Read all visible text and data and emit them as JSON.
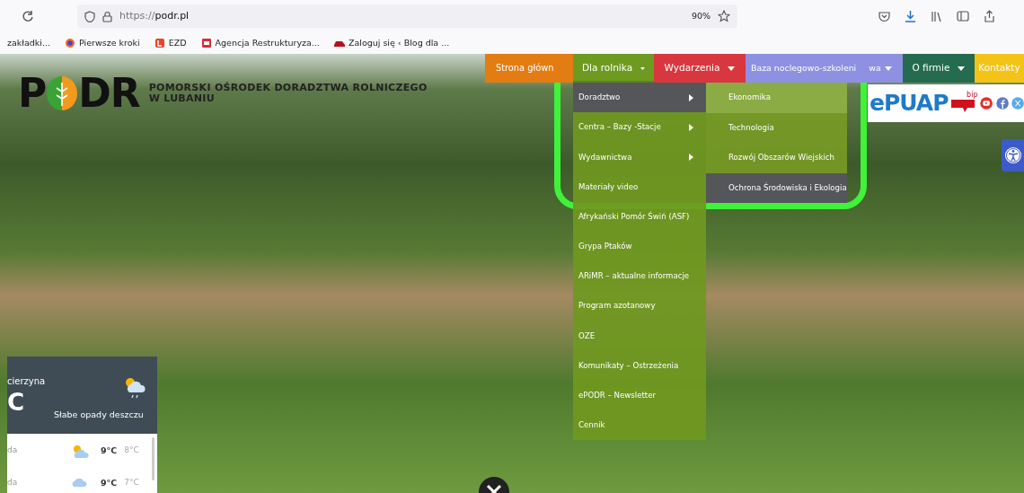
{
  "browser": {
    "url_scheme": "https://",
    "url_host": "podr.pl",
    "zoom": "90%",
    "bookmarks": [
      {
        "label": "zakładki...",
        "kind": "plain"
      },
      {
        "label": "Pierwsze kroki",
        "kind": "firefox"
      },
      {
        "label": "EZD",
        "kind": "ezd"
      },
      {
        "label": "Agencja Restrukturyza...",
        "kind": "agency"
      },
      {
        "label": "Zaloguj się ‹ Blog dla ...",
        "kind": "car"
      }
    ]
  },
  "site": {
    "logo": {
      "left": "P",
      "right": "DR",
      "line1": "POMORSKI OŚRODEK DORADZTWA ROLNICZEGO",
      "line2": "W LUBANIU"
    },
    "nav": [
      {
        "label": "Strona główn",
        "color": "#e37c12",
        "selected": false,
        "caret": false
      },
      {
        "label": "Dla rolnika",
        "color": "#6f9a22",
        "selected": true,
        "caret": true
      },
      {
        "label": "Wydarzenia",
        "color": "#d8373f",
        "selected": false,
        "caret": true
      },
      {
        "label": "Baza noclegowo-szkoleni",
        "label_tail": "wa",
        "color": "#8e90e2",
        "selected": false,
        "caret": true
      },
      {
        "label": "O firmie",
        "color": "#246b50",
        "selected": false,
        "caret": true
      },
      {
        "label": "Kontakty",
        "color": "#f4c318",
        "selected": false,
        "caret": false
      }
    ],
    "dropdown": [
      {
        "label": "Doradztwo",
        "submenu": true,
        "selected": true
      },
      {
        "label": "Centra – Bazy -Stacje",
        "submenu": true,
        "selected": false
      },
      {
        "label": "Wydawnictwa",
        "submenu": true,
        "selected": false
      },
      {
        "label": "Materiały video",
        "submenu": false,
        "selected": false
      },
      {
        "label": "Afrykański Pomór Świń (ASF)",
        "submenu": false,
        "selected": false
      },
      {
        "label": "Grypa Ptaków",
        "submenu": false,
        "selected": false
      },
      {
        "label": "ARiMR – aktualne informacje",
        "submenu": false,
        "selected": false
      },
      {
        "label": "Program azotanowy",
        "submenu": false,
        "selected": false
      },
      {
        "label": "OZE",
        "submenu": false,
        "selected": false
      },
      {
        "label": "Komunikaty – Ostrzeżenia",
        "submenu": false,
        "selected": false
      },
      {
        "label": "ePODR – Newsletter",
        "submenu": false,
        "selected": false
      },
      {
        "label": "Cennik",
        "submenu": false,
        "selected": false
      }
    ],
    "submenu": [
      {
        "label": "Ekonomika",
        "highlighted": true,
        "selected": false
      },
      {
        "label": "Technologia",
        "highlighted": false,
        "selected": false
      },
      {
        "label": "Rozwój Obszarów Wiejskich",
        "highlighted": false,
        "selected": false
      },
      {
        "label": "Ochrona Środowiska i Ekologia",
        "highlighted": false,
        "selected": true
      }
    ],
    "epuap": "ePUAP",
    "bip": "bip"
  },
  "weather": {
    "location": "cierzyna",
    "temperature": "C",
    "condition": "Słabe opady deszczu",
    "forecast": [
      {
        "day": "da",
        "kind": "partly-sunny",
        "high": "9°C",
        "low": "8°C"
      },
      {
        "day": "da",
        "kind": "cloudy",
        "high": "9°C",
        "low": "7°C"
      }
    ]
  }
}
